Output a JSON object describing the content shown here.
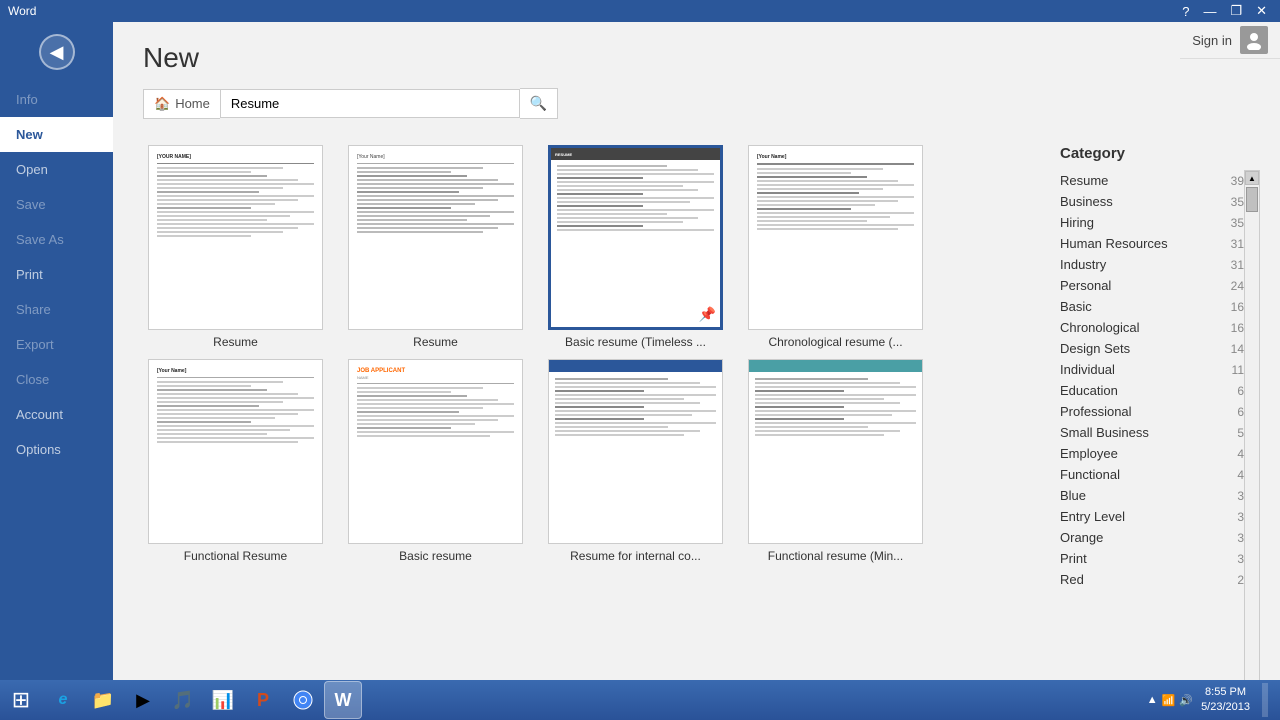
{
  "titlebar": {
    "title": "Word",
    "help_icon": "?",
    "minimize": "—",
    "restore": "❐",
    "close": "✕"
  },
  "sidebar": {
    "back_btn": "◀",
    "items": [
      {
        "id": "info",
        "label": "Info",
        "state": "inactive"
      },
      {
        "id": "new",
        "label": "New",
        "state": "active"
      },
      {
        "id": "open",
        "label": "Open",
        "state": "normal"
      },
      {
        "id": "save",
        "label": "Save",
        "state": "inactive"
      },
      {
        "id": "saveas",
        "label": "Save As",
        "state": "inactive"
      },
      {
        "id": "print",
        "label": "Print",
        "state": "normal"
      },
      {
        "id": "share",
        "label": "Share",
        "state": "inactive"
      },
      {
        "id": "export",
        "label": "Export",
        "state": "inactive"
      },
      {
        "id": "close",
        "label": "Close",
        "state": "inactive"
      },
      {
        "id": "account",
        "label": "Account",
        "state": "normal"
      },
      {
        "id": "options",
        "label": "Options",
        "state": "normal"
      }
    ]
  },
  "main": {
    "title": "New",
    "search_placeholder": "Resume",
    "home_label": "Home",
    "search_icon": "🔍"
  },
  "templates": [
    {
      "id": "t1",
      "label": "Resume",
      "style": "plain",
      "selected": false
    },
    {
      "id": "t2",
      "label": "Resume",
      "style": "plain2",
      "selected": false
    },
    {
      "id": "t3",
      "label": "Basic resume (Timeless ...",
      "style": "dark_header",
      "selected": true,
      "has_pin": true
    },
    {
      "id": "t4",
      "label": "Chronological resume (...",
      "style": "plain3",
      "selected": false
    },
    {
      "id": "t5",
      "label": "Functional Resume",
      "style": "plain",
      "selected": false
    },
    {
      "id": "t6",
      "label": "Basic resume",
      "style": "colored_name",
      "selected": false
    },
    {
      "id": "t7",
      "label": "Resume for internal co...",
      "style": "teal_header",
      "selected": false
    },
    {
      "id": "t8",
      "label": "Functional resume (Min...",
      "style": "teal_header2",
      "selected": false
    }
  ],
  "categories": {
    "title": "Category",
    "items": [
      {
        "label": "Resume",
        "count": 39
      },
      {
        "label": "Business",
        "count": 35
      },
      {
        "label": "Hiring",
        "count": 35
      },
      {
        "label": "Human Resources",
        "count": 31
      },
      {
        "label": "Industry",
        "count": 31
      },
      {
        "label": "Personal",
        "count": 24
      },
      {
        "label": "Basic",
        "count": 16
      },
      {
        "label": "Chronological",
        "count": 16
      },
      {
        "label": "Design Sets",
        "count": 14
      },
      {
        "label": "Individual",
        "count": 11
      },
      {
        "label": "Education",
        "count": 6
      },
      {
        "label": "Professional",
        "count": 6
      },
      {
        "label": "Small Business",
        "count": 5
      },
      {
        "label": "Employee",
        "count": 4
      },
      {
        "label": "Functional",
        "count": 4
      },
      {
        "label": "Blue",
        "count": 3
      },
      {
        "label": "Entry Level",
        "count": 3
      },
      {
        "label": "Orange",
        "count": 3
      },
      {
        "label": "Print",
        "count": 3
      },
      {
        "label": "Red",
        "count": 2
      }
    ]
  },
  "taskbar": {
    "start_icon": "⊞",
    "icons": [
      {
        "id": "ie",
        "symbol": "e",
        "color": "#1ba1e2",
        "label": "IE"
      },
      {
        "id": "explorer",
        "symbol": "📁",
        "color": "#f0c040",
        "label": "Explorer"
      },
      {
        "id": "media",
        "symbol": "▶",
        "color": "#ff6600",
        "label": "Media Player"
      },
      {
        "id": "unknown1",
        "symbol": "♪",
        "color": "#ff5500",
        "label": "Media"
      },
      {
        "id": "unknown2",
        "symbol": "📊",
        "color": "#ff8800",
        "label": "Charts"
      },
      {
        "id": "powerpoint",
        "symbol": "P",
        "color": "#d04b1e",
        "label": "PowerPoint"
      },
      {
        "id": "chrome",
        "symbol": "◑",
        "color": "#4285f4",
        "label": "Chrome"
      },
      {
        "id": "word",
        "symbol": "W",
        "color": "#2b579a",
        "label": "Word",
        "active": true
      }
    ],
    "sign_in": "Sign in",
    "time": "8:55 PM",
    "date": "5/23/2013"
  }
}
